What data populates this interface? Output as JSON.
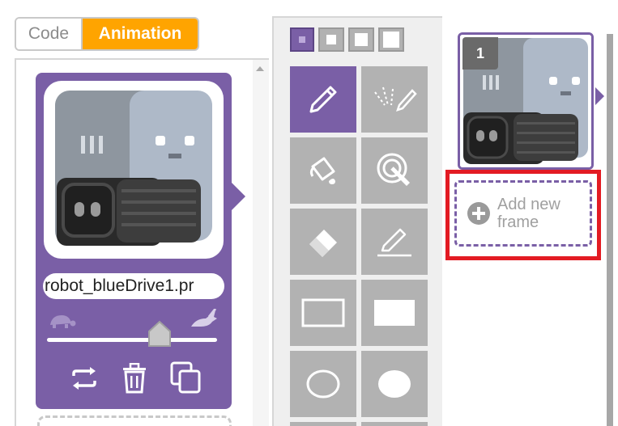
{
  "mode_toggle": {
    "code_label": "Code",
    "animation_label": "Animation"
  },
  "animation_list": {
    "selected": {
      "name": "robot_blueDrive1.pr",
      "speed_slow_icon": "turtle-icon",
      "speed_fast_icon": "rabbit-icon",
      "speed_fraction": 0.66,
      "actions": [
        "loop-icon",
        "trash-icon",
        "duplicate-icon"
      ]
    }
  },
  "tools": {
    "brush_sizes": [
      "size-1",
      "size-2",
      "size-3",
      "size-4"
    ],
    "selected_size": "size-1",
    "items": [
      {
        "id": "pencil",
        "icon": "pencil-icon"
      },
      {
        "id": "line",
        "icon": "line-icon"
      },
      {
        "id": "fill",
        "icon": "paint-bucket-icon"
      },
      {
        "id": "eyedropper",
        "icon": "eyedropper-icon"
      },
      {
        "id": "eraser",
        "icon": "eraser-icon"
      },
      {
        "id": "pen",
        "icon": "pen-line-icon"
      },
      {
        "id": "rect-outline",
        "icon": "rectangle-outline-icon"
      },
      {
        "id": "rect-filled",
        "icon": "rectangle-filled-icon"
      },
      {
        "id": "ellipse-outline",
        "icon": "ellipse-outline-icon"
      },
      {
        "id": "ellipse-filled",
        "icon": "ellipse-filled-icon"
      }
    ],
    "selected_tool": "pencil"
  },
  "frames": {
    "items": [
      {
        "number": "1"
      }
    ],
    "add_label": "Add new frame",
    "add_icon": "plus-circle-icon"
  },
  "colors": {
    "accent_purple": "#7a5fa6",
    "animation_orange": "#ffa400",
    "highlight_red": "#e31b23",
    "tool_gray": "#b2b2b2"
  }
}
